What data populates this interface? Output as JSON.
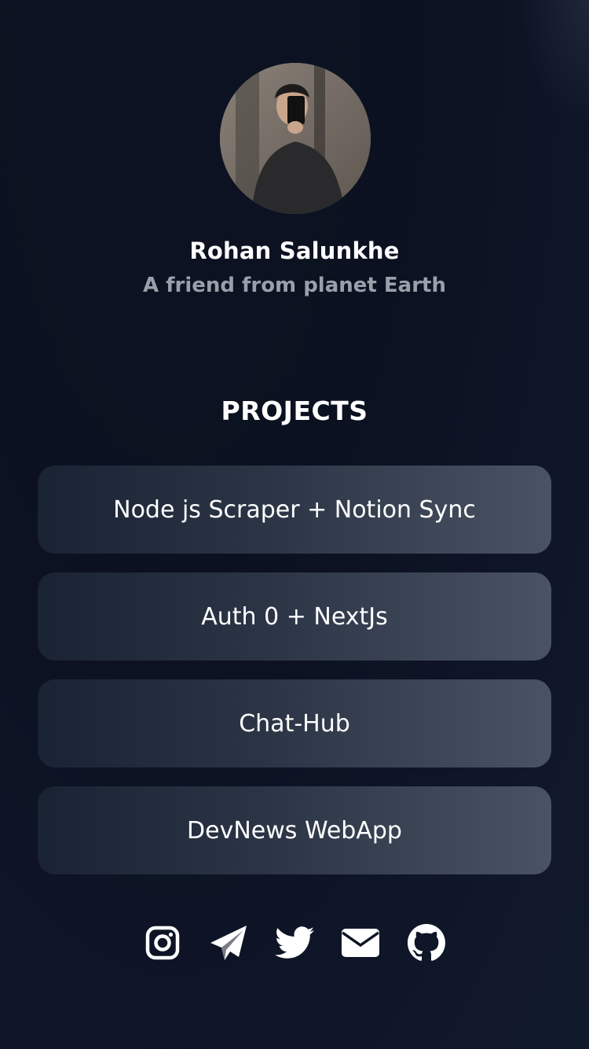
{
  "profile": {
    "name": "Rohan Salunkhe",
    "tagline": "A friend from planet Earth"
  },
  "projects": {
    "title": "PROJECTS",
    "items": [
      {
        "label": "Node js Scraper + Notion Sync"
      },
      {
        "label": "Auth 0 + NextJs"
      },
      {
        "label": "Chat-Hub"
      },
      {
        "label": "DevNews WebApp"
      }
    ]
  },
  "socials": [
    {
      "icon": "instagram-icon"
    },
    {
      "icon": "telegram-icon"
    },
    {
      "icon": "twitter-icon"
    },
    {
      "icon": "mail-icon"
    },
    {
      "icon": "github-icon"
    }
  ],
  "colors": {
    "background": "#0b1120",
    "card_start": "#1a2333",
    "card_end": "#4a5364",
    "tagline": "#9aa0a9"
  }
}
